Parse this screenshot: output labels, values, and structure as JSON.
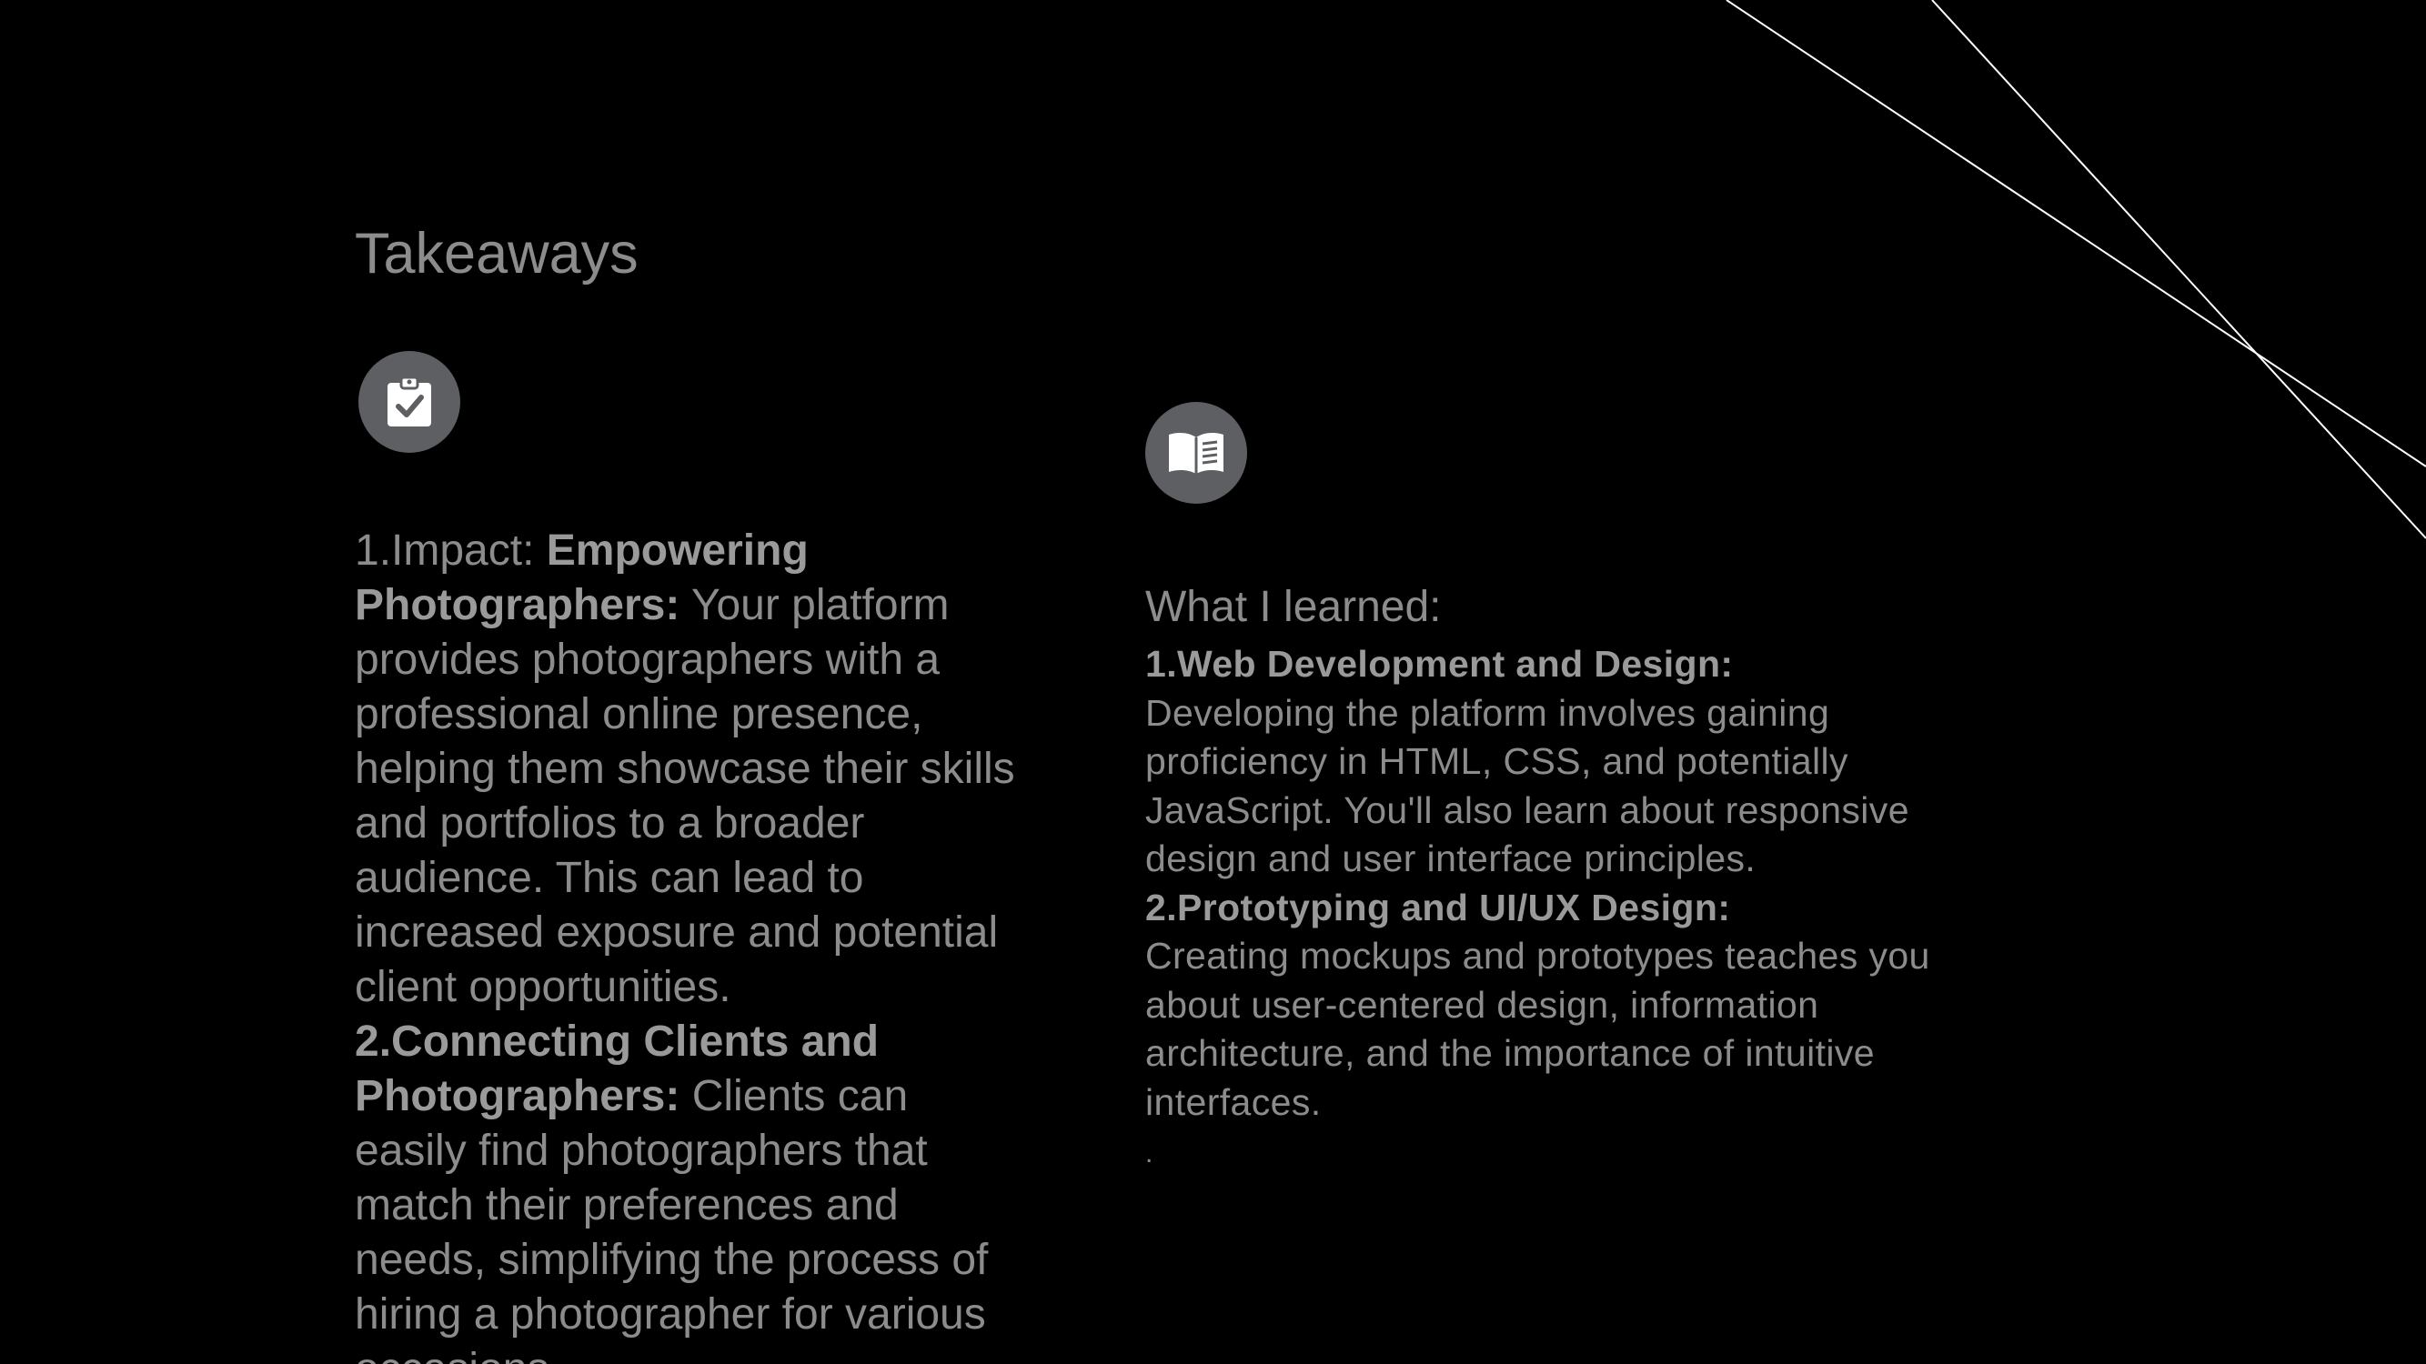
{
  "slide": {
    "title": "Takeaways",
    "colors": {
      "background": "#000000",
      "text": "#8c8c8c",
      "icon_badge": "#5d5f63",
      "deco_lines": "#ffffff"
    },
    "left": {
      "icon": "clipboard-check-icon",
      "items": [
        {
          "prefix": "1.Impact: ",
          "bold": "Empowering Photographers:",
          "text": " Your platform provides photographers with a professional online presence, helping them showcase their skills and portfolios to a broader audience. This can lead to increased exposure and potential client opportunities."
        },
        {
          "prefix": "",
          "bold": "2.Connecting Clients and Photographers:",
          "text": " Clients can easily find photographers that match their preferences and needs, simplifying the process of hiring a photographer for various occasions."
        }
      ]
    },
    "right": {
      "icon": "open-book-icon",
      "heading": "What I learned:",
      "items": [
        {
          "bold": "1.Web Development and Design:",
          "text": "Developing the platform involves gaining proficiency in HTML, CSS, and potentially JavaScript. You'll also learn about responsive design and user interface principles."
        },
        {
          "bold": "2.Prototyping and UI/UX Design:",
          "text": "Creating mockups and prototypes teaches you about user-centered design, information architecture, and the importance of intuitive interfaces."
        }
      ],
      "trailing": "."
    }
  }
}
